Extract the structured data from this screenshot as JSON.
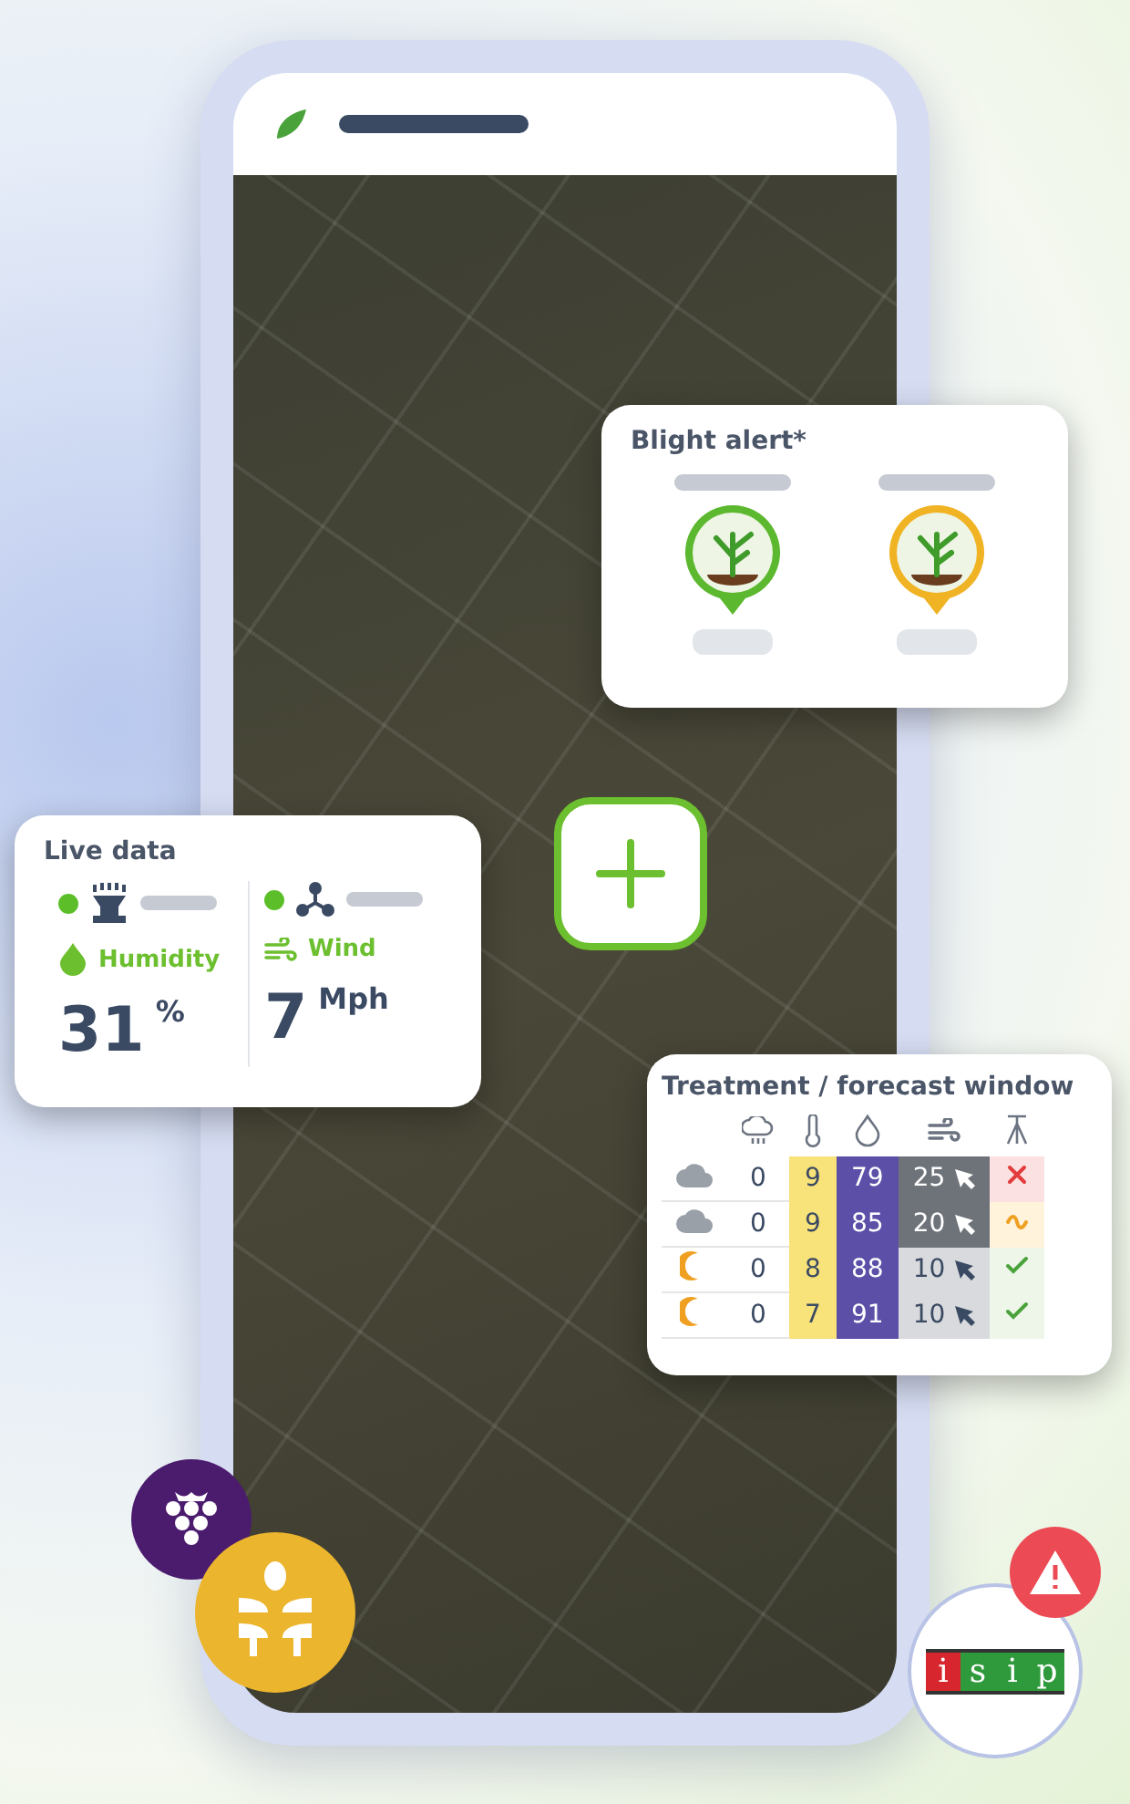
{
  "live_data": {
    "title": "Live data",
    "sensors": [
      {
        "kind": "humidity",
        "online": true,
        "label": "Humidity",
        "value": "31",
        "unit": "%"
      },
      {
        "kind": "wind",
        "online": true,
        "label": "Wind",
        "value": "7",
        "unit": "Mph"
      }
    ]
  },
  "blight_alert": {
    "title": "Blight alert*",
    "markers": [
      {
        "color": "#5cb82e"
      },
      {
        "color": "#f0b323"
      }
    ]
  },
  "forecast": {
    "title": "Treatment / forecast window",
    "rows": [
      {
        "weather": {
          "kind": "cloud"
        },
        "rain": "0",
        "temp": "9",
        "humidity": "79",
        "wind": "25",
        "wind_strong": true,
        "verdict": {
          "kind": "no"
        }
      },
      {
        "weather": {
          "kind": "cloud"
        },
        "rain": "0",
        "temp": "9",
        "humidity": "85",
        "wind": "20",
        "wind_strong": true,
        "verdict": {
          "kind": "maybe"
        }
      },
      {
        "weather": {
          "kind": "moon"
        },
        "rain": "0",
        "temp": "8",
        "humidity": "88",
        "wind": "10",
        "wind_strong": false,
        "verdict": {
          "kind": "yes"
        }
      },
      {
        "weather": {
          "kind": "moon"
        },
        "rain": "0",
        "temp": "7",
        "humidity": "91",
        "wind": "10",
        "wind_strong": false,
        "verdict": {
          "kind": "yes"
        }
      }
    ]
  },
  "logo_letters": [
    "i",
    "s",
    "i",
    "p"
  ]
}
